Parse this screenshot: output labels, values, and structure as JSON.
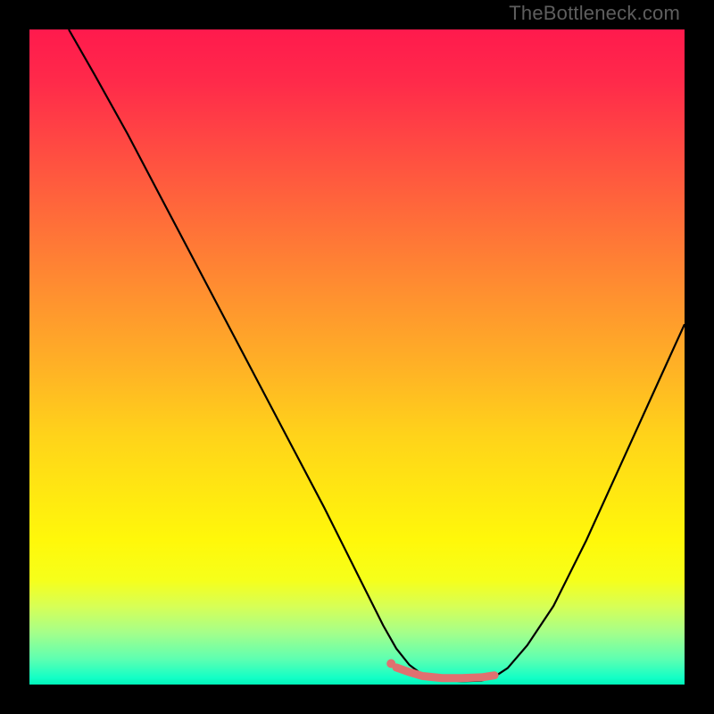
{
  "watermark": "TheBottleneck.com",
  "chart_data": {
    "type": "line",
    "title": "",
    "xlabel": "",
    "ylabel": "",
    "xlim": [
      0,
      100
    ],
    "ylim": [
      0,
      100
    ],
    "grid": false,
    "series": [
      {
        "name": "curve",
        "x": [
          6,
          10,
          15,
          20,
          25,
          30,
          35,
          40,
          45,
          50,
          54,
          56,
          58,
          60,
          63,
          66,
          69,
          71,
          73,
          76,
          80,
          85,
          90,
          95,
          100
        ],
        "y": [
          100,
          93,
          84,
          74.5,
          65,
          55.5,
          46,
          36.5,
          27,
          17,
          9,
          5.5,
          3,
          1.5,
          0.7,
          0.5,
          0.6,
          1.2,
          2.5,
          6,
          12,
          22,
          33,
          44,
          55
        ]
      }
    ],
    "highlight_segment": {
      "x": [
        56,
        58,
        60,
        63,
        66,
        69,
        71
      ],
      "y": [
        2.6,
        1.9,
        1.3,
        1.0,
        1.0,
        1.1,
        1.4
      ]
    },
    "highlight_start_dot": {
      "x": 55.2,
      "y": 3.2
    },
    "gradient_stops": [
      {
        "pct": 0,
        "color": "#ff1a4d"
      },
      {
        "pct": 50,
        "color": "#ffc61a"
      },
      {
        "pct": 80,
        "color": "#fff80a"
      },
      {
        "pct": 100,
        "color": "#00f5b8"
      }
    ]
  }
}
